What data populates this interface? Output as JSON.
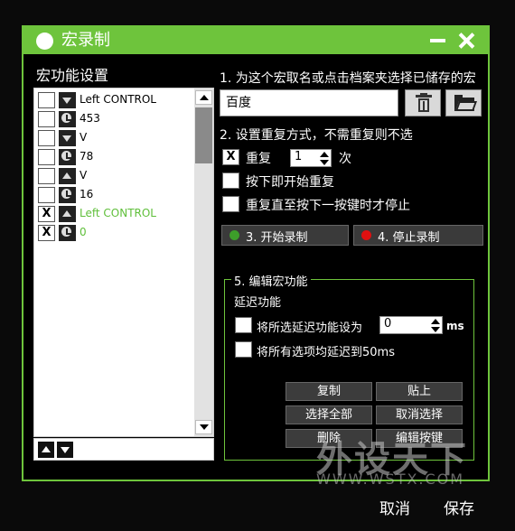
{
  "window": {
    "title": "宏录制"
  },
  "left": {
    "title": "宏功能设置",
    "items": [
      {
        "checked": false,
        "icon": "down-arrow-icon",
        "text": "Left CONTROL",
        "green": false
      },
      {
        "checked": false,
        "icon": "clock-icon",
        "text": "453",
        "green": false
      },
      {
        "checked": false,
        "icon": "down-arrow-icon",
        "text": "V",
        "green": false
      },
      {
        "checked": false,
        "icon": "clock-icon",
        "text": "78",
        "green": false
      },
      {
        "checked": false,
        "icon": "up-arrow-icon",
        "text": "V",
        "green": false
      },
      {
        "checked": false,
        "icon": "clock-icon",
        "text": "16",
        "green": false
      },
      {
        "checked": true,
        "icon": "up-arrow-icon",
        "text": "Left CONTROL",
        "green": true
      },
      {
        "checked": true,
        "icon": "clock-icon",
        "text": "0",
        "green": true
      }
    ],
    "check_mark": "X"
  },
  "right": {
    "step1": "1. 为这个宏取名或点击档案夹选择已储存的宏",
    "name_value": "百度",
    "step2": "2. 设置重复方式，不需重复则不选",
    "repeat_mark": "X",
    "repeat_label": "重复",
    "repeat_count": "1",
    "repeat_unit": "次",
    "opt_press_repeat": "按下即开始重复",
    "opt_repeat_until": "重复直至按下一按键时才停止",
    "start_btn": "3.  开始录制",
    "stop_btn": "4. 停止录制",
    "group_title": "5. 编辑宏功能",
    "delay_title": "延迟功能",
    "delay_set_label": "将所选延迟功能设为",
    "delay_value": "0",
    "delay_unit": "ms",
    "delay_all_label": "将所有选项均延迟到50ms",
    "btn_copy": "复制",
    "btn_paste": "贴上",
    "btn_select_all": "选择全部",
    "btn_deselect": "取消选择",
    "btn_delete": "删除",
    "btn_edit_key": "编辑按键"
  },
  "footer": {
    "cancel": "取消",
    "save": "保存"
  },
  "watermark": {
    "main": "外设天下",
    "sub": "WWW.WSTX.COM"
  },
  "colors": {
    "accent": "#6ec43c",
    "start_led": "#3d9e2a",
    "stop_led": "#e01010"
  }
}
